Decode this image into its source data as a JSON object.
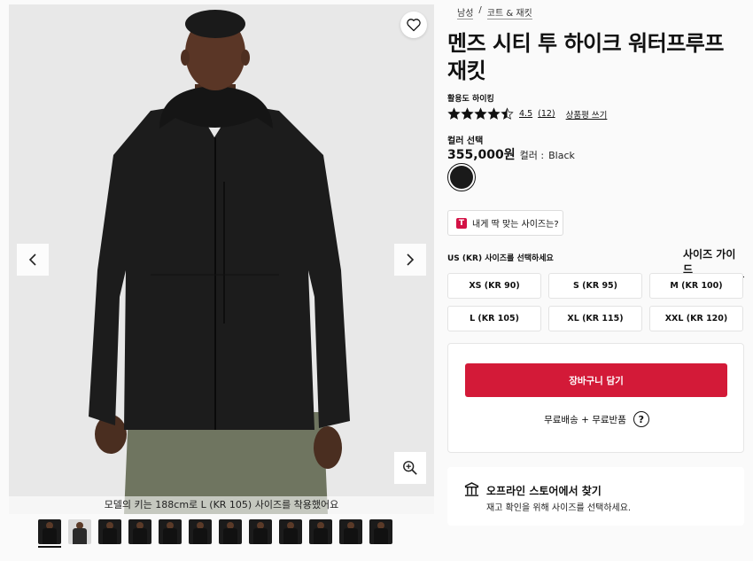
{
  "breadcrumb": [
    "남성",
    "코트 & 재킷"
  ],
  "product": {
    "title": "멘즈 시티 투 하이크 워터프루프 재킷",
    "activity": "활용도 하이킹",
    "rating": "4.5",
    "review_count": "(12)",
    "write_review": "상품평 쓰기",
    "stars_filled": 4.5,
    "color_section_label": "컬러 선택",
    "price": "355,000원",
    "color_prefix": "컬러 :",
    "color_name": "Black"
  },
  "fit_finder": {
    "label": "내게 딱 맞는 사이즈는?",
    "logo": "T"
  },
  "sizes": {
    "prompt": "US (KR) 사이즈를 선택하세요",
    "guide": "사이즈 가이드",
    "options": [
      "XS (KR 90)",
      "S (KR 95)",
      "M (KR 100)",
      "L (KR 105)",
      "XL (KR 115)",
      "XXL (KR 120)"
    ]
  },
  "cart": {
    "add_label": "장바구니 담기",
    "shipping": "무료배송 + 무료반품",
    "help": "?"
  },
  "store": {
    "title": "오프라인 스토어에서 찾기",
    "subtitle": "재고 확인을 위해 사이즈를 선택하세요."
  },
  "gallery": {
    "model_note": "모델의 키는 188cm로 L (KR 105) 사이즈를 착용했어요",
    "thumbnail_count": 12,
    "selected_index": 0
  },
  "colors": {
    "accent": "#d31a38",
    "jacket": "#1c1c1c",
    "pants": "#6f7560"
  },
  "icons": [
    "heart-icon",
    "chevron-left-icon",
    "chevron-right-icon",
    "zoom-in-icon",
    "star-icon",
    "store-icon",
    "help-icon"
  ]
}
